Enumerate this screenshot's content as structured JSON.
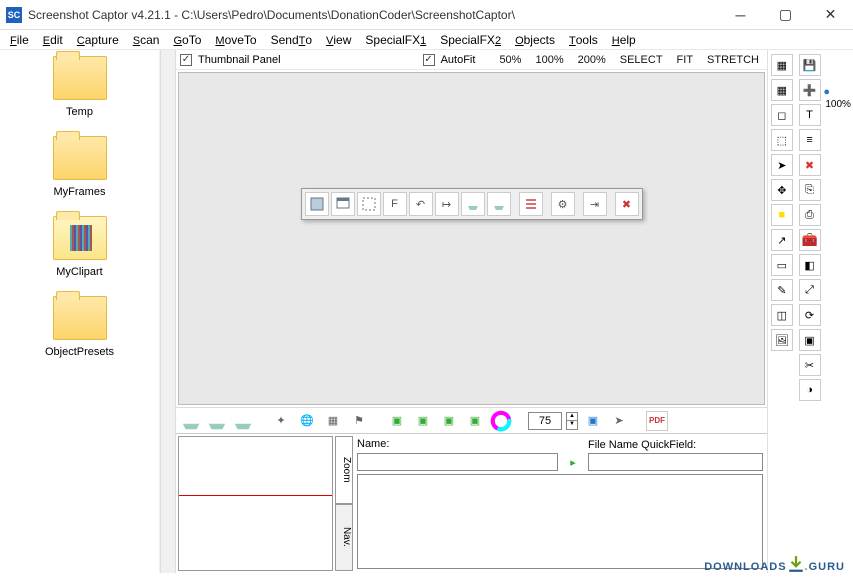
{
  "window": {
    "title": "Screenshot Captor v4.21.1 - C:\\Users\\Pedro\\Documents\\DonationCoder\\ScreenshotCaptor\\"
  },
  "menu": {
    "items": [
      "File",
      "Edit",
      "Capture",
      "Scan",
      "GoTo",
      "MoveTo",
      "SendTo",
      "View",
      "SpecialFX1",
      "SpecialFX2",
      "Objects",
      "Tools",
      "Help"
    ]
  },
  "sidebar": {
    "folders": [
      {
        "label": "Temp",
        "kind": "plain"
      },
      {
        "label": "MyFrames",
        "kind": "plain"
      },
      {
        "label": "MyClipart",
        "kind": "clip"
      },
      {
        "label": "ObjectPresets",
        "kind": "plain"
      }
    ]
  },
  "canvasbar": {
    "thumbnail_label": "Thumbnail Panel",
    "autofit_label": "AutoFit",
    "zoom_levels": [
      "50%",
      "100%",
      "200%"
    ],
    "fit_modes": [
      "SELECT",
      "FIT",
      "STRETCH"
    ]
  },
  "floating_toolbar": {
    "buttons": [
      {
        "name": "region-icon"
      },
      {
        "name": "window-icon"
      },
      {
        "name": "select-region-icon"
      },
      {
        "name": "fixed-icon",
        "glyph": "F"
      },
      {
        "name": "undo-icon",
        "glyph": "↶"
      },
      {
        "name": "redo-icon",
        "glyph": "↦"
      },
      {
        "name": "scanner-icon"
      },
      {
        "name": "camera-icon"
      },
      {
        "name": "sep"
      },
      {
        "name": "list-icon"
      },
      {
        "name": "sep"
      },
      {
        "name": "gear-icon",
        "glyph": "⚙"
      },
      {
        "name": "sep"
      },
      {
        "name": "exit-icon",
        "glyph": "⇥"
      },
      {
        "name": "sep"
      },
      {
        "name": "delete-icon",
        "glyph": "✖"
      }
    ]
  },
  "bottombar": {
    "zoom_value": "75",
    "pdf_label": "PDF"
  },
  "zoompane": {
    "tabs": [
      "Zoom",
      "Nav."
    ],
    "name_label": "Name:",
    "quickfield_label": "File Name QuickField:"
  },
  "right_tools": {
    "col1": [
      "grid",
      "grid",
      "crop",
      "crop-sel",
      "cursor",
      "move",
      "rect-yellow",
      "arrow",
      "text-box",
      "marker",
      "overlay",
      "image"
    ],
    "col2": [
      "save",
      "plus-red",
      "text-tool",
      "layers",
      "clear",
      "copy",
      "print",
      "toolbox",
      "coloradj",
      "resize",
      "rotate",
      "rect-dots",
      "crop2",
      "color"
    ],
    "zoom_label": "100%"
  },
  "watermark": {
    "left": "DOWNLOADS",
    "right": "GURU"
  }
}
